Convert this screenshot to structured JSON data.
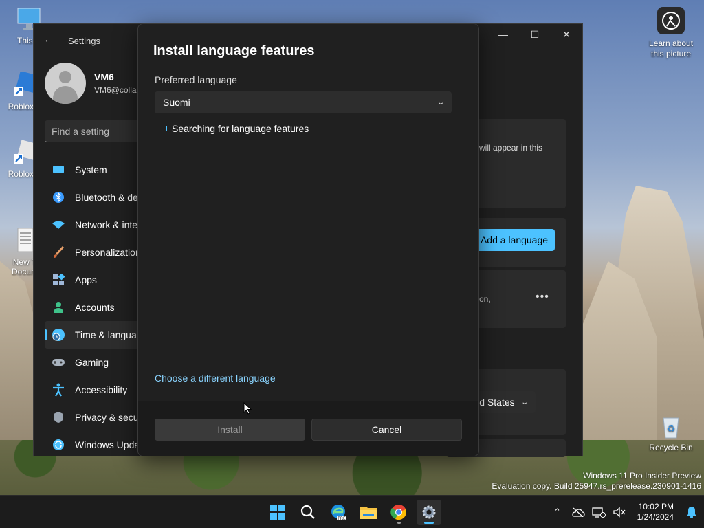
{
  "desktop": {
    "icons": [
      {
        "label": "This P"
      },
      {
        "label": "Roblox S"
      },
      {
        "label": "Roblox P"
      },
      {
        "label": "New T\nDocum"
      },
      {
        "label": "Recycle Bin"
      }
    ],
    "learn_picture_label": "Learn about this picture",
    "watermark_line1": "Windows 11 Pro Insider Preview",
    "watermark_line2": "Evaluation copy. Build 25947.rs_prerelease.230901-1416"
  },
  "settings": {
    "app_title": "Settings",
    "user_name": "VM6",
    "user_email": "VM6@collal",
    "search_placeholder": "Find a setting",
    "nav_items": [
      {
        "label": "System",
        "icon": "system-icon",
        "color": "#4cc2ff"
      },
      {
        "label": "Bluetooth & de",
        "icon": "bluetooth-icon",
        "color": "#3b9cff"
      },
      {
        "label": "Network & inte",
        "icon": "wifi-icon",
        "color": "#4cc2ff"
      },
      {
        "label": "Personalization",
        "icon": "brush-icon",
        "color": "#e8a06a"
      },
      {
        "label": "Apps",
        "icon": "apps-icon",
        "color": "#9fb7d8"
      },
      {
        "label": "Accounts",
        "icon": "accounts-icon",
        "color": "#3fc28a"
      },
      {
        "label": "Time & langua",
        "icon": "globe-clock-icon",
        "color": "#4cc2ff",
        "active": true
      },
      {
        "label": "Gaming",
        "icon": "gamepad-icon",
        "color": "#aab4c0"
      },
      {
        "label": "Accessibility",
        "icon": "accessibility-icon",
        "color": "#4cc2ff"
      },
      {
        "label": "Privacy & secu",
        "icon": "shield-icon",
        "color": "#9aa4b0"
      },
      {
        "label": "Windows Upda",
        "icon": "update-icon",
        "color": "#4cc2ff"
      }
    ],
    "fragment_will_appear": "will appear in this",
    "add_language_label": "Add a language",
    "fragment_on": "on,",
    "region_fragment": "d States"
  },
  "dialog": {
    "title": "Install language features",
    "preferred_label": "Preferred language",
    "selected_language": "Suomi",
    "status_text": "Searching for language features",
    "choose_link": "Choose a different language",
    "install_label": "Install",
    "cancel_label": "Cancel"
  },
  "taskbar": {
    "apps": [
      "start-icon",
      "search-icon",
      "edge-icon",
      "file-explorer-icon",
      "chrome-icon",
      "settings-icon"
    ],
    "time": "10:02 PM",
    "date": "1/24/2024"
  },
  "colors": {
    "accent": "#4cc2ff",
    "link": "#8ad4ff"
  }
}
